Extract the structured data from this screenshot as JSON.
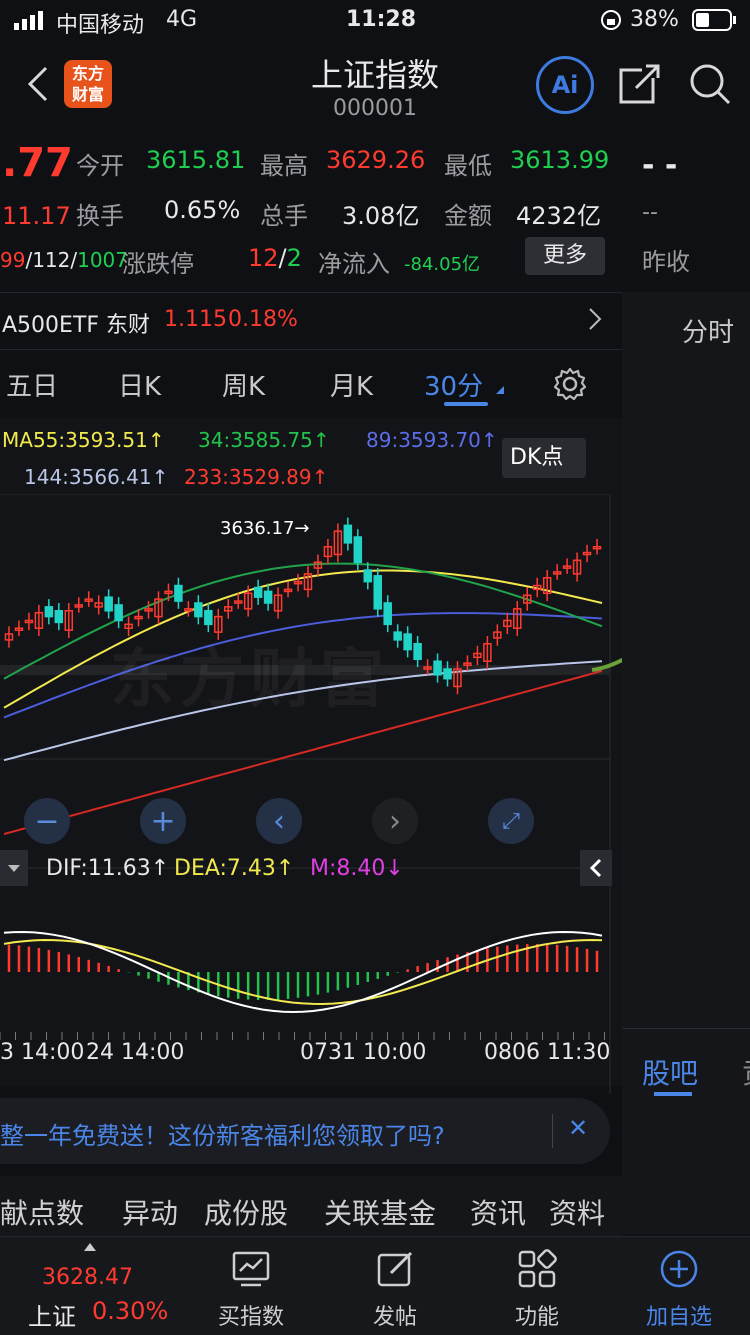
{
  "status": {
    "carrier": "中国移动",
    "network": "4G",
    "time": "11:28",
    "battery": "38%"
  },
  "header": {
    "title": "上证指数",
    "code": "000001",
    "logo_line1": "东方",
    "logo_line2": "财富",
    "ai_label": "Ai"
  },
  "quote": {
    "price_partial": ".77",
    "change_partial": "11.17",
    "open_label": "今开",
    "open": "3615.81",
    "high_label": "最高",
    "high": "3629.26",
    "low_label": "最低",
    "low": "3613.99",
    "turnover_label": "换手",
    "turnover": "0.65%",
    "volume_label": "总手",
    "volume": "3.08亿",
    "amount_label": "金额",
    "amount": "4232亿",
    "ud_red": "99",
    "ud_mid": "/112/",
    "ud_green": "1007",
    "limit_label": "涨跌停",
    "limit_up": "12",
    "limit_sep": "/",
    "limit_down": "2",
    "inflow_label": "净流入",
    "inflow": "-84.05亿",
    "more": "更多",
    "right_dash1": "- -",
    "right_dash2": "--",
    "prev_close_label": "昨收"
  },
  "etf": {
    "name": "A500ETF 东财",
    "price": "1.115",
    "pct": "0.18%"
  },
  "tabs": [
    {
      "label": "五日"
    },
    {
      "label": "日K"
    },
    {
      "label": "周K"
    },
    {
      "label": "月K"
    },
    {
      "label": "30分"
    }
  ],
  "right_panel": {
    "tab_fenshi": "分时",
    "tab_guba": "股吧"
  },
  "ma": {
    "ma55": "MA55:3593.51↑",
    "ma34": "34:3585.75↑",
    "ma89": "89:3593.70↑",
    "ma144": "144:3566.41↑",
    "ma233": "233:3529.89↑",
    "dk": "DK点",
    "peak": "3636.17→"
  },
  "macd": {
    "dif": "DIF:11.63↑",
    "dea": "DEA:7.43↑",
    "m": "M:8.40↓"
  },
  "time_axis": [
    "3 14:00",
    "24 14:00",
    "0731 10:00",
    "0806 11:30"
  ],
  "watermark": "东方财富",
  "promo": {
    "text": "整一年免费送！这份新客福利您领取了吗?",
    "close": "✕"
  },
  "subtabs": [
    "贡献点数",
    "异动",
    "成份股",
    "关联基金",
    "资讯",
    "资料"
  ],
  "bottom": {
    "index_value": "3628.47",
    "index_name": "上证",
    "index_pct": "0.30%",
    "items": [
      {
        "label": "买指数"
      },
      {
        "label": "发帖"
      },
      {
        "label": "功能"
      },
      {
        "label": "加自选"
      }
    ]
  },
  "chart_data": {
    "type": "candlestick",
    "note_series": [
      "MA55",
      "MA34",
      "MA89",
      "MA144",
      "MA233"
    ],
    "macd": {
      "dif": 11.63,
      "dea": 7.43,
      "m": 8.4
    },
    "candles_close": [
      3583,
      3586,
      3590,
      3594,
      3592,
      3589,
      3595,
      3598,
      3601,
      3599,
      3595,
      3590,
      3588,
      3592,
      3596,
      3601,
      3605,
      3600,
      3596,
      3592,
      3588,
      3592,
      3597,
      3600,
      3604,
      3602,
      3599,
      3603,
      3606,
      3610,
      3614,
      3620,
      3628,
      3636,
      3630,
      3620,
      3610,
      3596,
      3588,
      3580,
      3575,
      3570,
      3566,
      3562,
      3560,
      3565,
      3568,
      3573,
      3578,
      3584,
      3590,
      3596,
      3603,
      3608,
      3612,
      3615,
      3618,
      3621,
      3625,
      3628
    ],
    "ylim": [
      3480,
      3650
    ]
  }
}
